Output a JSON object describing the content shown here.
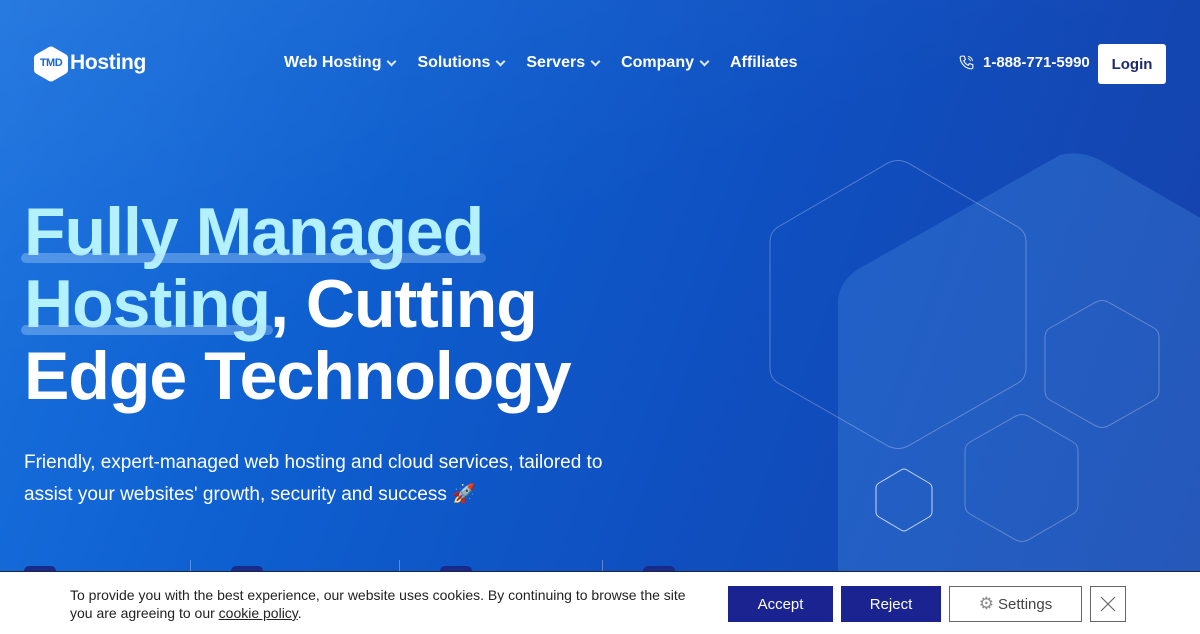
{
  "header": {
    "logo_badge": "TMD",
    "logo_text": "Hosting",
    "nav": [
      {
        "label": "Web Hosting",
        "has_dropdown": true
      },
      {
        "label": "Solutions",
        "has_dropdown": true
      },
      {
        "label": "Servers",
        "has_dropdown": true
      },
      {
        "label": "Company",
        "has_dropdown": true
      },
      {
        "label": "Affiliates",
        "has_dropdown": false
      }
    ],
    "phone_icon": "phone-icon",
    "phone": "1-888-771-5990",
    "login_label": "Login"
  },
  "hero": {
    "title_highlight_1": "Fully Managed",
    "title_highlight_2": "Hosting",
    "title_rest_1": ", Cutting",
    "title_rest_2": "Edge Technology",
    "subtitle": "Friendly, expert-managed web hosting and cloud services, tailored to assist your websites' growth, security and success",
    "subtitle_emoji": "🚀"
  },
  "cookie_bar": {
    "text": "To provide you with the best experience, our website uses cookies. By continuing to browse the site you are agreeing to our ",
    "link_text": "cookie policy",
    "text_end": ".",
    "accept_label": "Accept",
    "reject_label": "Reject",
    "settings_label": "Settings",
    "settings_icon": "gear-icon",
    "close_icon": "close-icon"
  },
  "colors": {
    "hero_bg": "#0f5fd0",
    "highlight_text": "#b3f1ff",
    "cookie_button": "#1a238f",
    "login_text": "#1b2a6b"
  }
}
